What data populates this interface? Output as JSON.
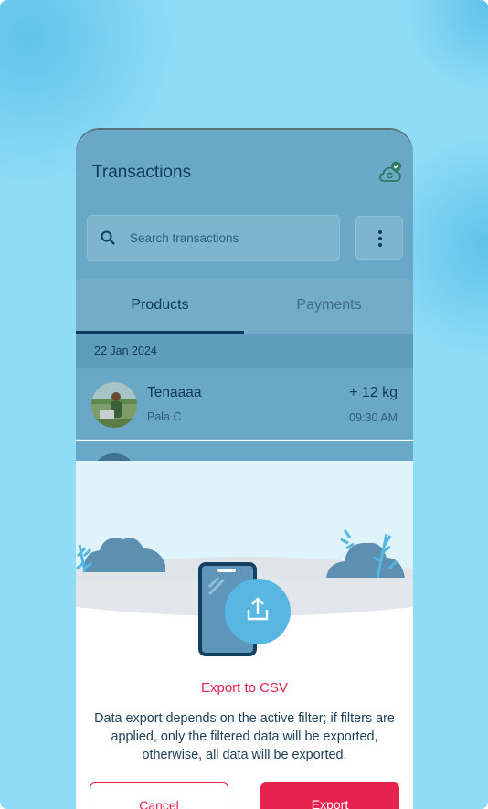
{
  "app": {
    "title": "Transactions",
    "sync_icon": "cloud-sync-check-icon"
  },
  "search": {
    "placeholder": "Search transactions",
    "icon": "search-icon"
  },
  "menu": {
    "icon": "more-vertical-icon"
  },
  "tabs": [
    {
      "label": "Products",
      "active": true
    },
    {
      "label": "Payments",
      "active": false
    }
  ],
  "list": {
    "date_header": "22 Jan 2024",
    "items": [
      {
        "name": "Tenaaaa",
        "subtitle": "Pala C",
        "quantity": "+ 12 kg",
        "time": "09:30 AM"
      }
    ]
  },
  "dialog": {
    "illustration": "phone-upload-illustration",
    "title": "Export to CSV",
    "description": "Data export depends on the active filter; if filters are applied, only the filtered data will be exported, otherwise, all data will be exported.",
    "cancel_label": "Cancel",
    "export_label": "Export"
  },
  "colors": {
    "accent": "#e3224f",
    "primary_dark": "#0f3b5a",
    "overlay_blue": "#69a8c6",
    "backdrop": "#8edcf6"
  }
}
